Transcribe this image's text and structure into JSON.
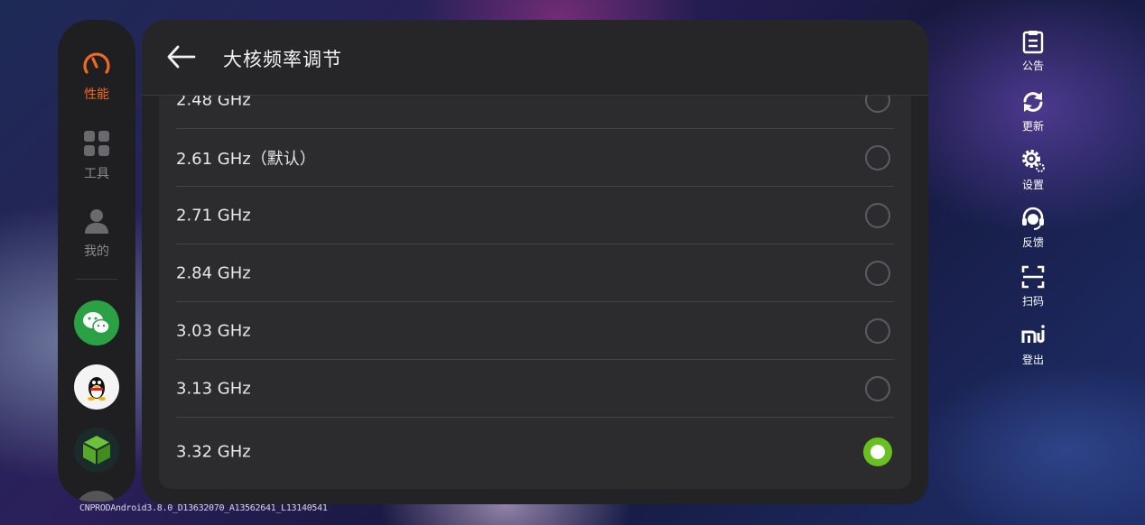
{
  "sidebar": {
    "items": [
      {
        "label": "性能",
        "icon": "gauge-icon",
        "active": true
      },
      {
        "label": "工具",
        "icon": "grid-icon",
        "active": false
      },
      {
        "label": "我的",
        "icon": "person-icon",
        "active": false
      }
    ],
    "apps": [
      {
        "icon": "wechat-icon"
      },
      {
        "icon": "qq-icon"
      },
      {
        "icon": "cube-app-icon"
      }
    ],
    "accent_color": "#f26a21"
  },
  "panel": {
    "title": "大核频率调节",
    "options": [
      {
        "label": "2.48 GHz",
        "selected": false
      },
      {
        "label": "2.61 GHz（默认）",
        "selected": false
      },
      {
        "label": "2.71 GHz",
        "selected": false
      },
      {
        "label": "2.84 GHz",
        "selected": false
      },
      {
        "label": "3.03 GHz",
        "selected": false
      },
      {
        "label": "3.13 GHz",
        "selected": false
      },
      {
        "label": "3.32 GHz",
        "selected": true
      }
    ],
    "selected_color": "#68c11f"
  },
  "right_menu": {
    "items": [
      {
        "label": "公告",
        "icon": "notice-icon"
      },
      {
        "label": "更新",
        "icon": "refresh-icon"
      },
      {
        "label": "设置",
        "icon": "gear-icon"
      },
      {
        "label": "反馈",
        "icon": "headset-icon"
      },
      {
        "label": "扫码",
        "icon": "scan-icon"
      },
      {
        "label": "登出",
        "icon": "mi-logo-icon"
      }
    ]
  },
  "footer": {
    "build_string": "CNPRODAndroid3.8.0_D13632070_A13562641_L13140541"
  }
}
